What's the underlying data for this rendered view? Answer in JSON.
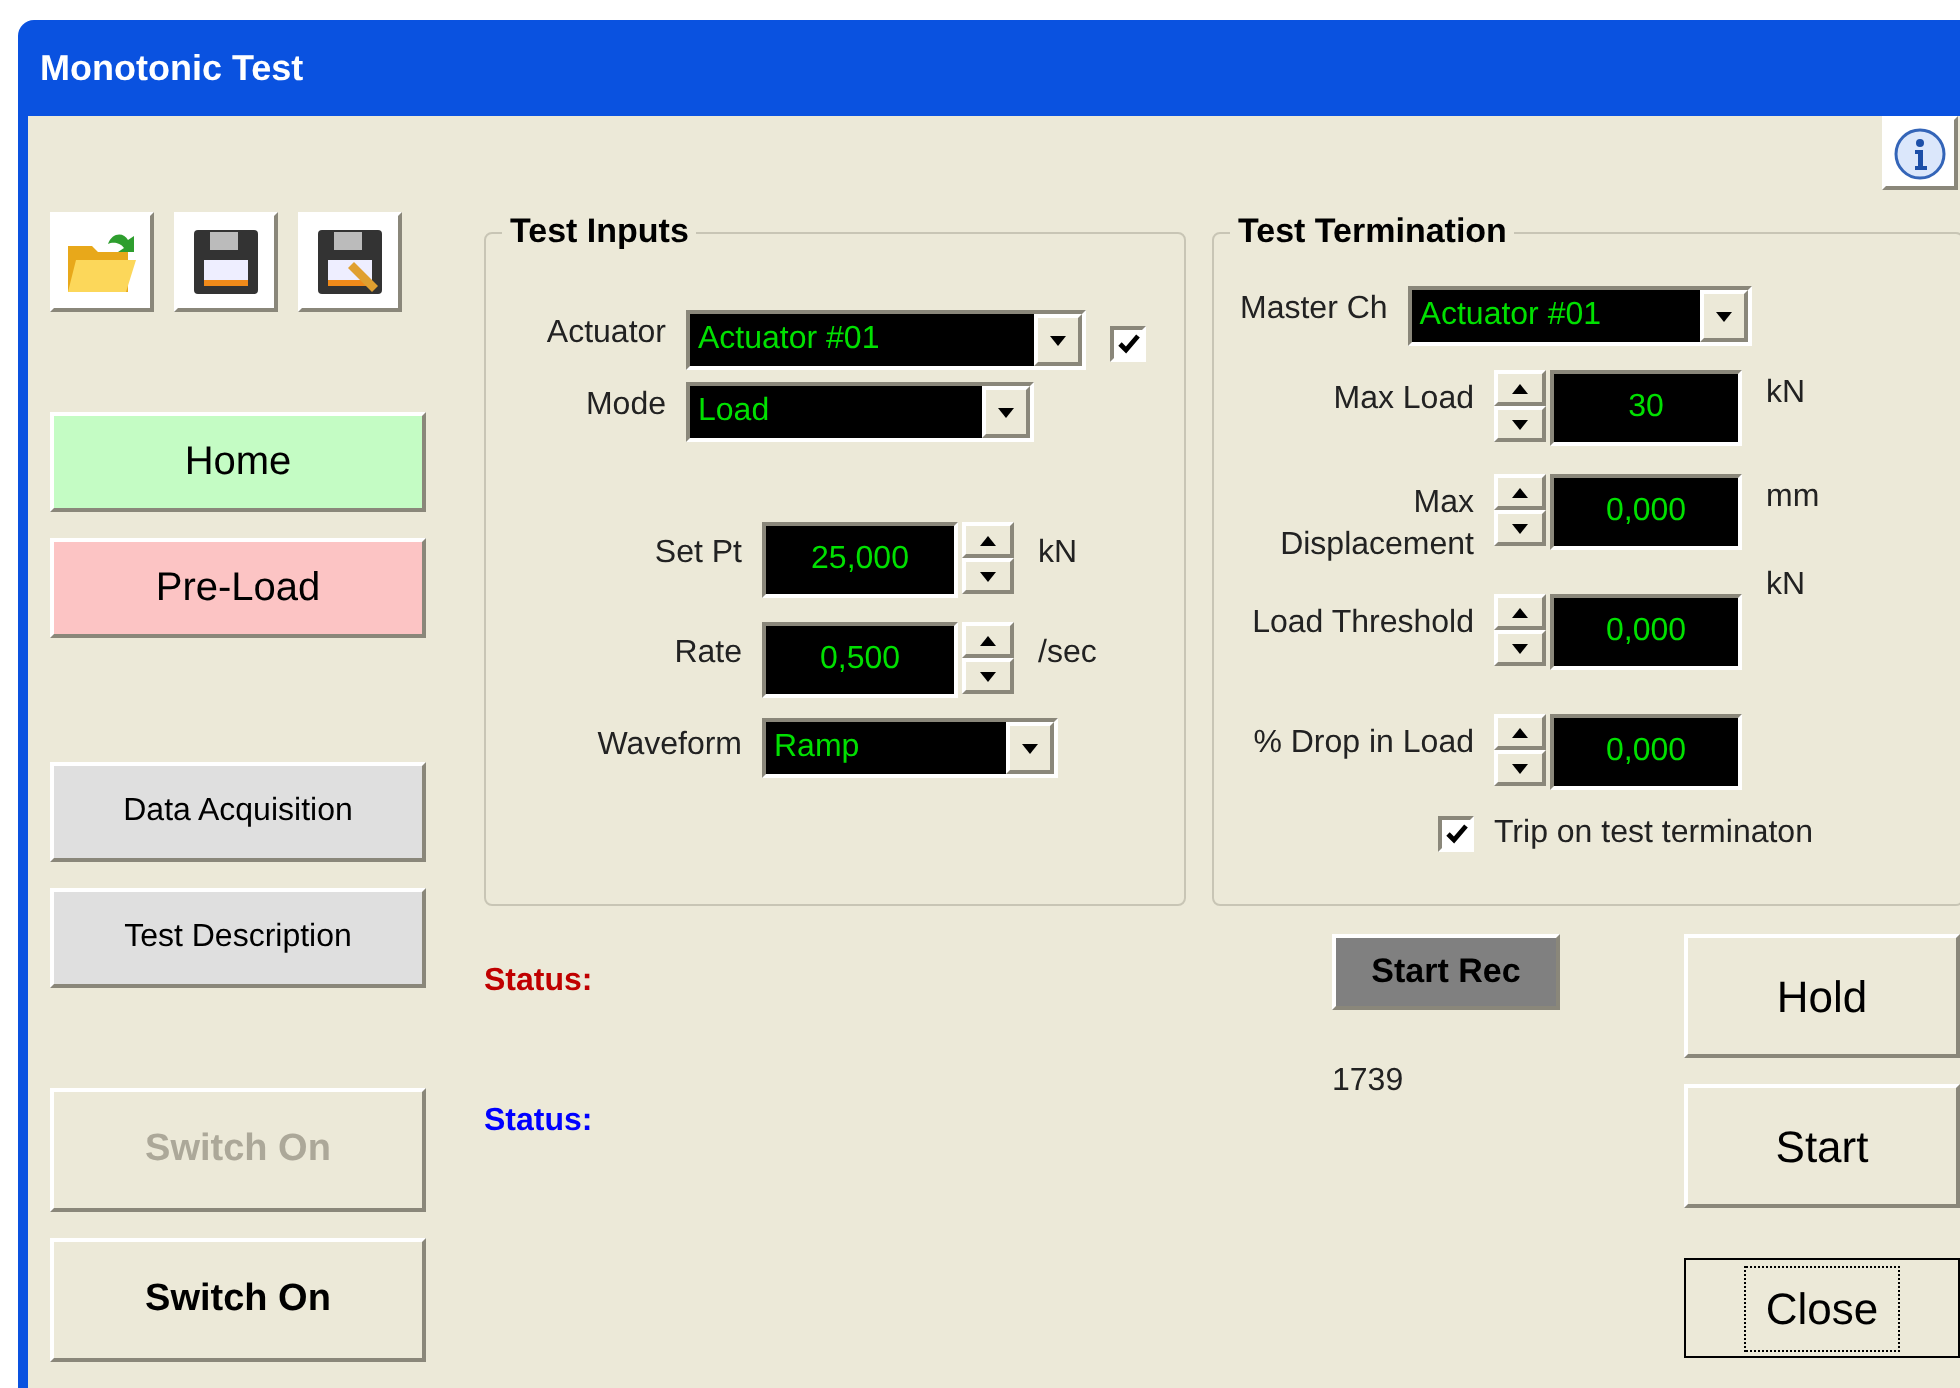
{
  "window": {
    "title": "Monotonic Test"
  },
  "nav_buttons": [
    {
      "label": "Home",
      "color": "#c4fcc4"
    },
    {
      "label": "Pre-Load",
      "color": "#fcc4c4"
    },
    {
      "label": "Data Acquisition",
      "color": "#dfdfdf"
    },
    {
      "label": "Test Description",
      "color": "#dfdfdf"
    }
  ],
  "switch_buttons": [
    {
      "label": "Switch On",
      "disabled": true
    },
    {
      "label": "Switch On",
      "disabled": false
    }
  ],
  "test_inputs": {
    "title": "Test Inputs",
    "actuator": {
      "label": "Actuator",
      "value": "Actuator #01",
      "checked": true
    },
    "mode": {
      "label": "Mode",
      "value": "Load"
    },
    "set_pt": {
      "label": "Set Pt",
      "value": "25,000",
      "unit": "kN"
    },
    "rate": {
      "label": "Rate",
      "value": "0,500",
      "unit": "/sec"
    },
    "waveform": {
      "label": "Waveform",
      "value": "Ramp"
    }
  },
  "test_termination": {
    "title": "Test Termination",
    "master_ch": {
      "label": "Master Ch",
      "value": "Actuator #01"
    },
    "rows": [
      {
        "label": "Max Load",
        "value": "30",
        "unit": "kN"
      },
      {
        "label": "Max Displacement",
        "value": "0,000",
        "unit": "mm"
      },
      {
        "label": "Load Threshold",
        "value": "0,000",
        "unit": "kN"
      },
      {
        "label": "% Drop in Load",
        "value": "0,000"
      }
    ],
    "trip": {
      "label": "Trip on test terminaton",
      "checked": true
    }
  },
  "status": [
    {
      "label": "Status:",
      "color": "#c00000"
    },
    {
      "label": "Status:",
      "color": "#0000ff"
    }
  ],
  "status_value": "1739",
  "start_rec": "Start Rec",
  "action_buttons": [
    {
      "label": "Hold",
      "focused": false
    },
    {
      "label": "Start",
      "focused": false
    },
    {
      "label": "Close",
      "focused": true
    }
  ]
}
